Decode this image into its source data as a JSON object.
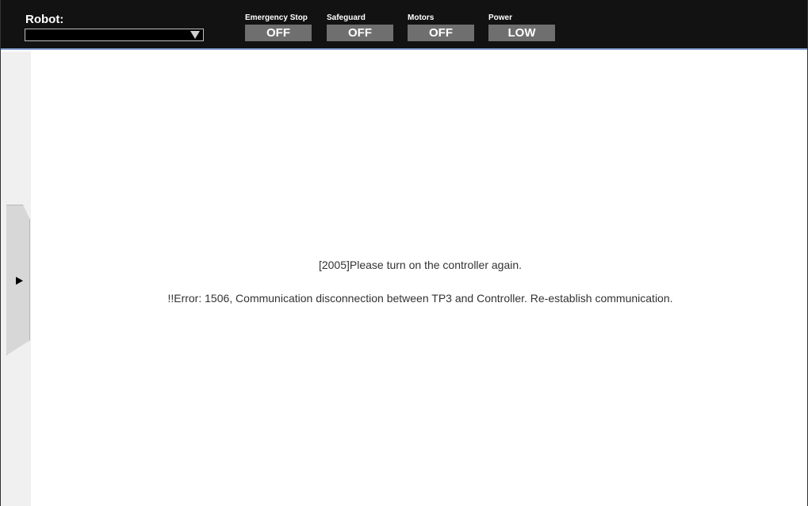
{
  "header": {
    "robot_label": "Robot:",
    "robot_selected": ""
  },
  "status": {
    "emergency_stop": {
      "label": "Emergency Stop",
      "value": "OFF"
    },
    "safeguard": {
      "label": "Safeguard",
      "value": "OFF"
    },
    "motors": {
      "label": "Motors",
      "value": "OFF"
    },
    "power": {
      "label": "Power",
      "value": "LOW"
    }
  },
  "messages": {
    "line1": "[2005]Please turn on the controller again.",
    "line2": "!!Error: 1506, Communication disconnection between TP3 and Controller. Re-establish communication."
  },
  "colors": {
    "topbar": "#121212",
    "status_box": "#6f6f6f",
    "accent_line": "#8aa6d6"
  }
}
